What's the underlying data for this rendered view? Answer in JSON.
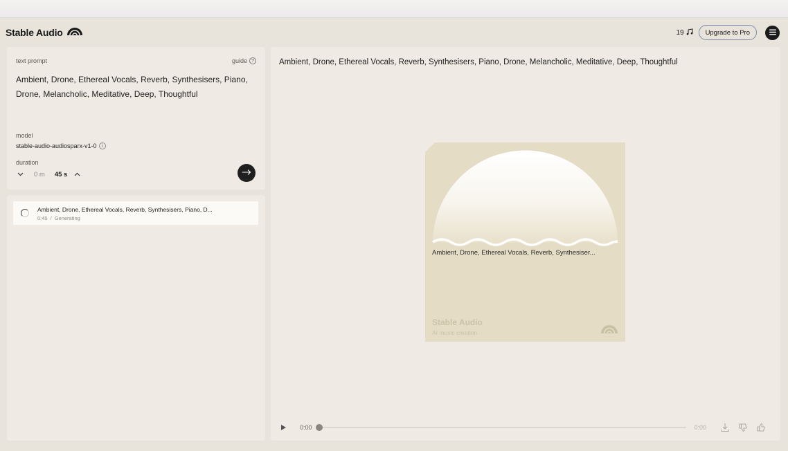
{
  "app": {
    "brand_name": "Stable Audio",
    "credits": "19",
    "upgrade_label": "Upgrade to Pro"
  },
  "prompt_panel": {
    "label": "text prompt",
    "guide_label": "guide",
    "prompt_text": "Ambient, Drone, Ethereal Vocals, Reverb, Synthesisers, Piano, Drone, Melancholic, Meditative, Deep, Thoughtful",
    "model_label": "model",
    "model_value": "stable-audio-audiosparx-v1-0",
    "duration_label": "duration",
    "duration_minutes": "0 m",
    "duration_seconds": "45 s"
  },
  "generations": [
    {
      "title": "Ambient, Drone, Ethereal Vocals, Reverb, Synthesisers, Piano, D...",
      "duration": "0:45",
      "separator": "/",
      "status": "Generating"
    }
  ],
  "main": {
    "title": "Ambient, Drone, Ethereal Vocals, Reverb, Synthesisers, Piano, Drone, Melancholic, Meditative, Deep, Thoughtful",
    "artwork": {
      "caption": "Ambient, Drone, Ethereal Vocals, Reverb, Synthesiser...",
      "brand": "Stable Audio",
      "subtitle": "AI music creation"
    },
    "player": {
      "current_time": "0:00",
      "total_time": "0:00",
      "progress": 0
    }
  },
  "colors": {
    "background": "#e8e4dc",
    "panel": "#efebe4",
    "artwork_bg": "#e4dcc4",
    "dark": "#1a1a1a",
    "upgrade_border": "#7a8aa8"
  },
  "icons": {
    "brand_logo": "rainbow-arch-icon",
    "credits": "music-note-icon",
    "menu": "hamburger-menu-icon",
    "guide": "question-circle-icon",
    "model_info": "info-circle-icon",
    "duration_down": "chevron-down-icon",
    "duration_up": "chevron-up-icon",
    "generate": "arrow-right-icon",
    "status": "spinner-icon",
    "play": "play-icon",
    "download": "download-icon",
    "dislike": "thumbs-down-icon",
    "like": "thumbs-up-icon"
  }
}
